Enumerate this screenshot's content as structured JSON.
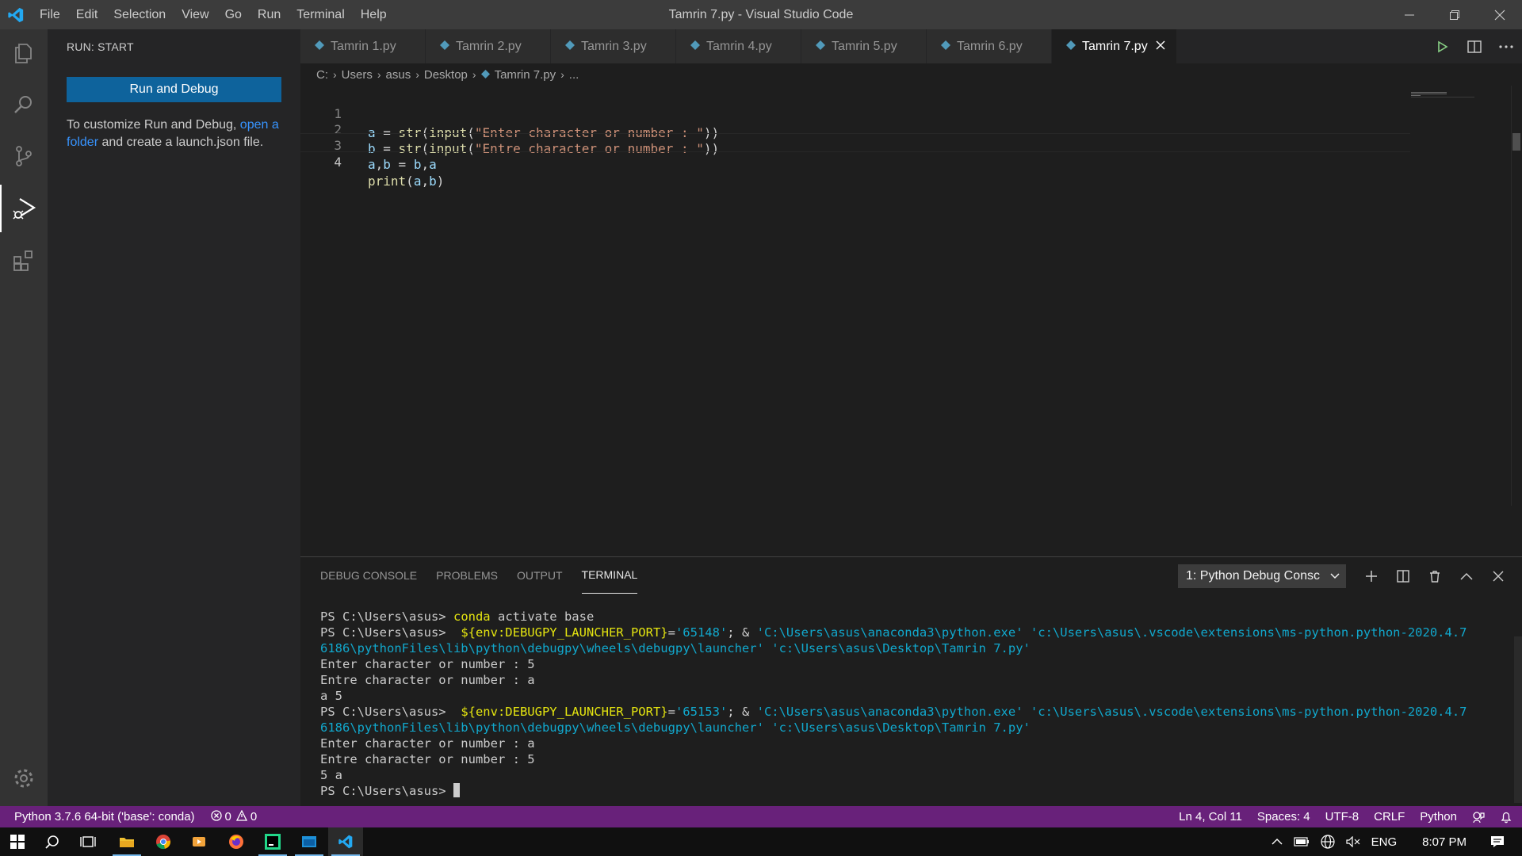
{
  "window": {
    "title": "Tamrin 7.py - Visual Studio Code",
    "menu": [
      "File",
      "Edit",
      "Selection",
      "View",
      "Go",
      "Run",
      "Terminal",
      "Help"
    ]
  },
  "sidebar": {
    "header": "RUN: START",
    "run_button": "Run and Debug",
    "text_before": "To customize Run and Debug, ",
    "link_text": "open a folder",
    "text_after": " and create a launch.json file."
  },
  "tabs": [
    {
      "label": "Tamrin 1.py",
      "active": false
    },
    {
      "label": "Tamrin 2.py",
      "active": false
    },
    {
      "label": "Tamrin 3.py",
      "active": false
    },
    {
      "label": "Tamrin 4.py",
      "active": false
    },
    {
      "label": "Tamrin 5.py",
      "active": false
    },
    {
      "label": "Tamrin 6.py",
      "active": false
    },
    {
      "label": "Tamrin 7.py",
      "active": true
    }
  ],
  "breadcrumb": [
    "C:",
    "Users",
    "asus",
    "Desktop",
    "Tamrin 7.py",
    "..."
  ],
  "editor": {
    "line_numbers": [
      "1",
      "2",
      "3",
      "4"
    ],
    "lines": [
      "a = str(input(\"Enter character or number : \"))",
      "b = str(input(\"Entre character or number : \"))",
      "a,b = b,a",
      "print(a,b)"
    ]
  },
  "panel": {
    "tabs": [
      "DEBUG CONSOLE",
      "PROBLEMS",
      "OUTPUT",
      "TERMINAL"
    ],
    "active_tab": "TERMINAL",
    "terminal_select": "1: Python Debug Consc",
    "terminal": {
      "prompt": "PS C:\\Users\\asus>",
      "cmd_conda": "conda",
      "cmd_conda_rest": " activate base",
      "env_var": "${env:DEBUGPY_LAUNCHER_PORT}",
      "eq": "=",
      "port1": "'65148'",
      "port2": "'65153'",
      "amp": "; & ",
      "python_exe": "'C:\\Users\\asus\\anaconda3\\python.exe'",
      "launcher_a": "'c:\\Users\\asus\\.vscode\\extensions\\ms-python.python-2020.4.7",
      "launcher_b": "6186\\pythonFiles\\lib\\python\\debugpy\\wheels\\debugpy\\launcher'",
      "script_path": "'c:\\Users\\asus\\Desktop\\Tamrin 7.py'",
      "run1": [
        "Enter character or number : 5",
        "Entre character or number : a",
        "a 5"
      ],
      "run2": [
        "Enter character or number : a",
        "Entre character or number : 5",
        "5 a"
      ]
    }
  },
  "statusbar": {
    "interpreter": "Python 3.7.6 64-bit ('base': conda)",
    "errors": "0",
    "warnings": "0",
    "position": "Ln 4, Col 11",
    "spaces": "Spaces: 4",
    "encoding": "UTF-8",
    "eol": "CRLF",
    "language": "Python"
  },
  "taskbar": {
    "language": "ENG",
    "time": "8:07 PM"
  },
  "colors": {
    "statusbar": "#68217a",
    "run_button": "#0e639c",
    "link": "#3794ff",
    "python_icon": "#519aba"
  }
}
